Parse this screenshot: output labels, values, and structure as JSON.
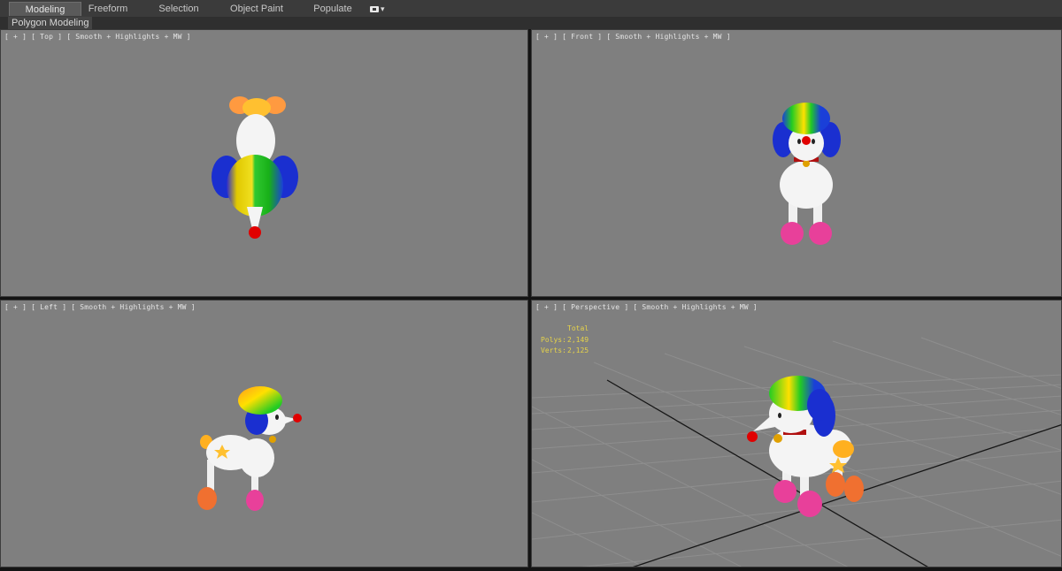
{
  "ribbon": {
    "tabs": [
      {
        "label": "Modeling",
        "active": true
      },
      {
        "label": "Freeform",
        "active": false
      },
      {
        "label": "Selection",
        "active": false
      },
      {
        "label": "Object Paint",
        "active": false
      },
      {
        "label": "Populate",
        "active": false
      }
    ],
    "extra_icon": "ribbon-options-icon",
    "panel_label": "Polygon Modeling"
  },
  "viewports": {
    "top": {
      "label": "[ + ] [ Top ] [ Smooth + Highlights + MW ]"
    },
    "front": {
      "label": "[ + ] [ Front ] [ Smooth + Highlights + MW ]"
    },
    "left": {
      "label": "[ + ] [ Left ] [ Smooth + Highlights + MW ]"
    },
    "perspective": {
      "label": "[ + ] [ Perspective ] [ Smooth + Highlights + MW ]"
    }
  },
  "stats": {
    "header": "Total",
    "polys_label": "Polys:",
    "polys_value": "2,149",
    "verts_label": "Verts:",
    "verts_value": "2,125"
  },
  "colors": {
    "viewport_bg": "#7f7f7f",
    "stats_text": "#e6d34a",
    "afro_rainbow": [
      "#ff8a00",
      "#ffe000",
      "#22cc22",
      "#1a3fd8"
    ],
    "body": "#f4f4f4",
    "nose": "#e00000",
    "boots_front": "#e8409a",
    "boots_back": "#f07030"
  }
}
